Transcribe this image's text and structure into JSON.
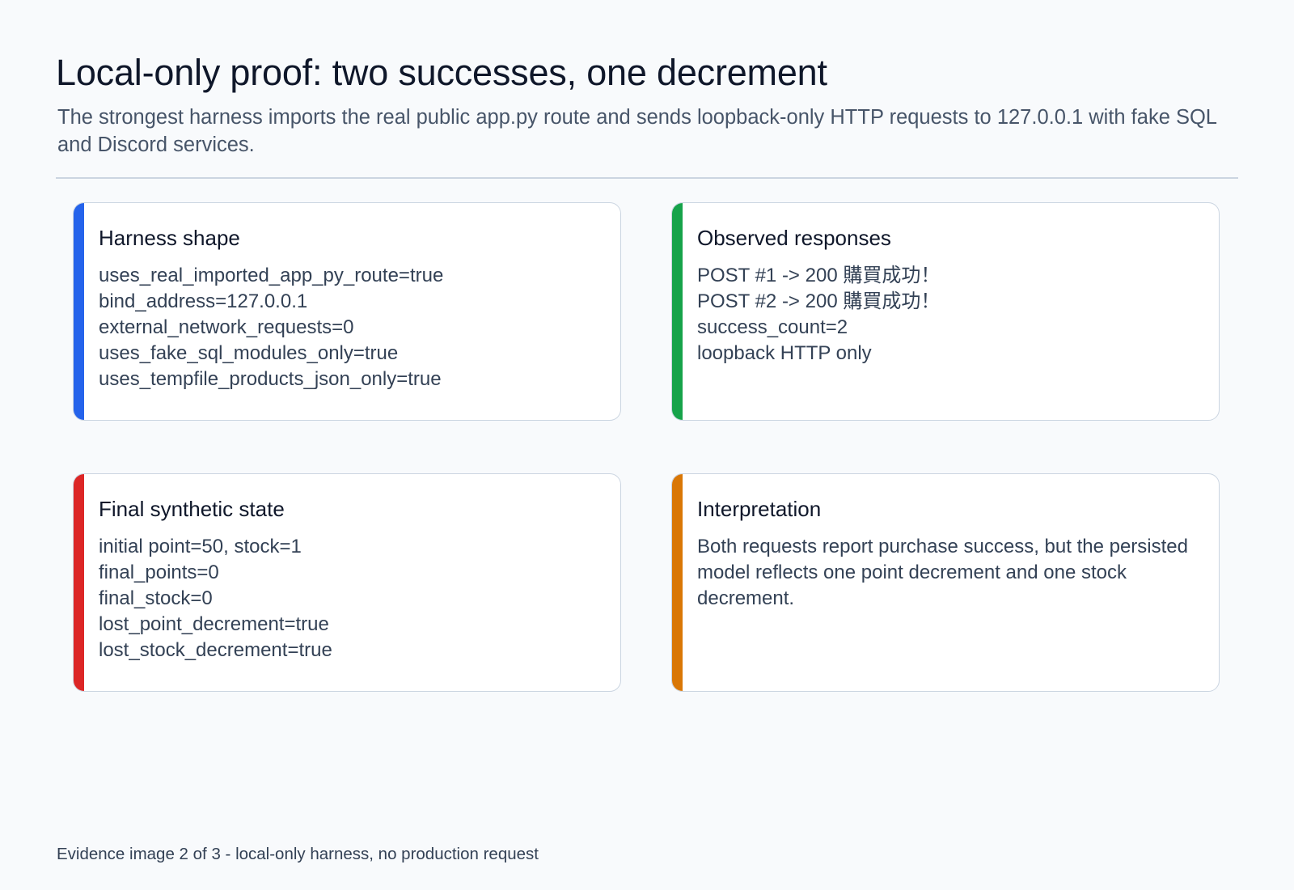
{
  "header": {
    "title": "Local-only proof: two successes, one decrement",
    "subtitle": "The strongest harness imports the real public app.py route and sends loopback-only HTTP requests to 127.0.0.1 with fake SQL and Discord services."
  },
  "colors": {
    "blue_accent": "#2563eb",
    "green_accent": "#16a34a",
    "red_accent": "#dc2626",
    "orange_accent": "#d97706"
  },
  "cards": {
    "harness": {
      "title": "Harness shape",
      "lines": [
        "uses_real_imported_app_py_route=true",
        "bind_address=127.0.0.1",
        "external_network_requests=0",
        "uses_fake_sql_modules_only=true",
        "uses_tempfile_products_json_only=true"
      ]
    },
    "observed": {
      "title": "Observed responses",
      "lines": [
        "POST #1 -> 200 購買成功！",
        "POST #2 -> 200 購買成功！",
        "success_count=2",
        "loopback HTTP only"
      ]
    },
    "final_state": {
      "title": "Final synthetic state",
      "lines": [
        "initial point=50, stock=1",
        "final_points=0",
        "final_stock=0",
        "lost_point_decrement=true",
        "lost_stock_decrement=true"
      ]
    },
    "interpretation": {
      "title": "Interpretation",
      "text": "Both requests report purchase success, but the persisted model reflects one point decrement and one stock decrement."
    }
  },
  "footer": {
    "text": "Evidence image 2 of 3 - local-only harness, no production request"
  }
}
